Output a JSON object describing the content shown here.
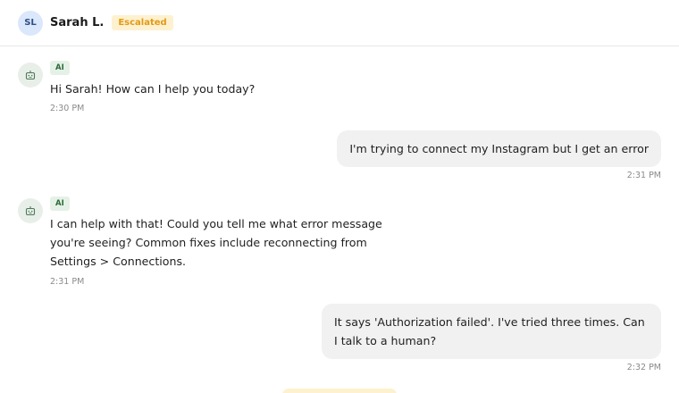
{
  "contact": {
    "initials": "SL",
    "name": "Sarah L.",
    "status": "Escalated"
  },
  "messages": [
    {
      "sender": "ai",
      "badge": "AI",
      "text": "Hi Sarah! How can I help you today?",
      "time": "2:30 PM"
    },
    {
      "sender": "user",
      "text": "I'm trying to connect my Instagram but I get an error",
      "time": "2:31 PM"
    },
    {
      "sender": "ai",
      "badge": "AI",
      "text": "I can help with that! Could you tell me what error message you're seeing? Common fixes include reconnecting from Settings > Connections.",
      "time": "2:31 PM"
    },
    {
      "sender": "user",
      "text": "It says 'Authorization failed'. I've tried three times. Can I talk to a human?",
      "time": "2:32 PM"
    }
  ],
  "colors": {
    "escalated_badge_bg": "#fdf1cf",
    "escalated_badge_text": "#e29a16",
    "ai_badge_bg": "#e5f1e7",
    "user_bubble_bg": "#f1f1f1"
  },
  "icons": {
    "bot": "robot-icon"
  }
}
